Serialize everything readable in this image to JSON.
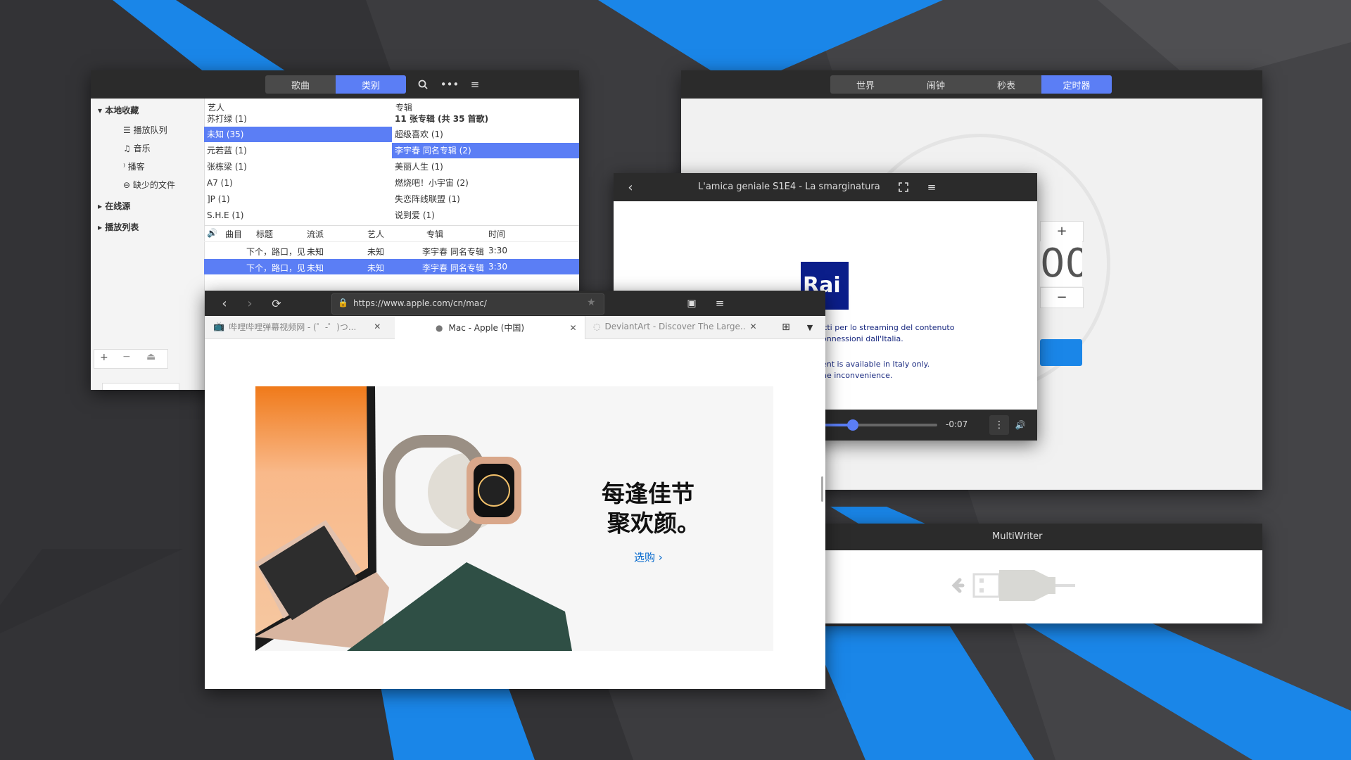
{
  "colors": {
    "accent": "#5b7ef5",
    "background": "#3b3b3e",
    "blue": "#1a86e8",
    "headerbar": "#2b2b2b"
  },
  "music": {
    "header_tabs": [
      "歌曲",
      "类别"
    ],
    "active_tab": "类别",
    "header_icons": [
      "search-icon",
      "more-icon",
      "menu-icon"
    ],
    "sidebar": {
      "local": "本地收藏",
      "items": [
        "播放队列",
        "音乐",
        "播客",
        "缺少的文件"
      ],
      "online": "在线源",
      "playlists": "播放列表"
    },
    "artist_header": "艺人",
    "album_header": "专辑",
    "artists": [
      "苏打绿 (1)",
      "未知 (35)",
      "元若蓝 (1)",
      "张栋梁 (1)",
      "A7 (1)",
      "]P (1)",
      "S.H.E (1)"
    ],
    "selected_artist": "未知 (35)",
    "albums": [
      "11 张专辑 (共 35 首歌)",
      "超级喜欢 (1)",
      "李宇春 同名专辑 (2)",
      "美丽人生 (1)",
      "燃烧吧！小宇宙 (2)",
      "失恋阵线联盟 (1)",
      "说到爱 (1)"
    ],
    "selected_album": "李宇春 同名专辑 (2)",
    "track_columns": [
      "曲目",
      "标题",
      "流派",
      "艺人",
      "专辑",
      "时间"
    ],
    "tracks": [
      {
        "title": "下个，路口，见",
        "genre": "未知",
        "artist": "未知",
        "album": "李宇春 同名专辑",
        "time": "3:30"
      },
      {
        "title": "下个，路口，见",
        "genre": "未知",
        "artist": "未知",
        "album": "李宇春 同名专辑",
        "time": "3:30"
      }
    ]
  },
  "clocks": {
    "tabs": [
      "世界",
      "闹钟",
      "秒表",
      "定时器"
    ],
    "active": "定时器",
    "timer_fragment": "00",
    "plus": "+",
    "minus": "−"
  },
  "video": {
    "title": "L'amica geniale S1E4 - La smarginatura",
    "logo": "Rai",
    "message_it": [
      "itti per lo streaming del contenuto",
      "onnessioni dall'Italia."
    ],
    "message_en": [
      "ent is available in Italy only.",
      "he inconvenience."
    ],
    "remaining": "-0:07",
    "progress": 0.25
  },
  "multiwriter": {
    "title": "MultiWriter"
  },
  "browser": {
    "url": "https://www.apple.com/cn/mac/",
    "tabs": [
      {
        "label": "哔哩哔哩弹幕视频网 - (゜-゜)つ...",
        "icon": "bilibili-icon"
      },
      {
        "label": "Mac - Apple (中国)",
        "icon": "apple-icon"
      },
      {
        "label": "DeviantArt - Discover The Large...",
        "icon": "loading-icon"
      }
    ],
    "promo": {
      "headline_1": "每逢佳节",
      "headline_2": "聚欢颜。",
      "link": "选购 ›"
    }
  }
}
